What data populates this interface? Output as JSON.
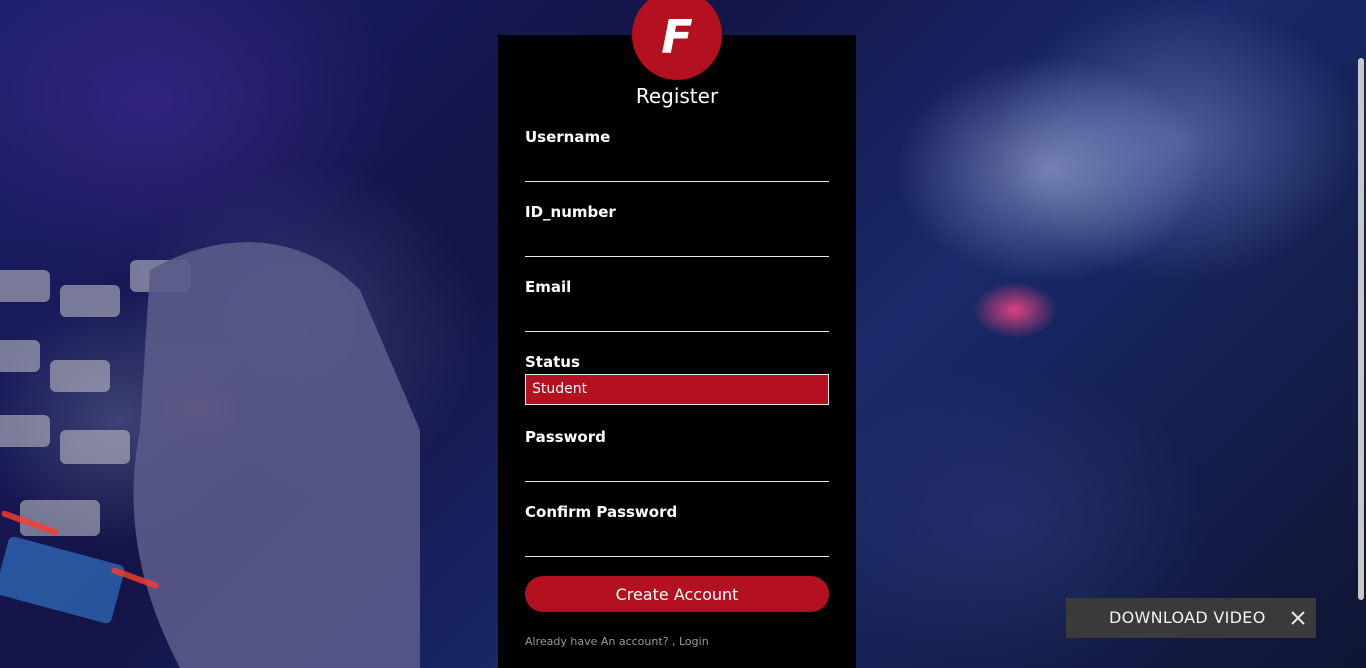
{
  "form": {
    "logo_letter": "F",
    "title": "Register",
    "fields": [
      {
        "label": "Username",
        "value": ""
      },
      {
        "label": "ID_number",
        "value": ""
      },
      {
        "label": "Email",
        "value": ""
      }
    ],
    "status": {
      "label": "Status",
      "selected": "Student"
    },
    "password_fields": [
      {
        "label": "Password",
        "value": ""
      },
      {
        "label": "Confirm Password",
        "value": ""
      }
    ],
    "submit_label": "Create Account",
    "login_prompt": "Already have An account? ,",
    "login_link": "Login"
  },
  "download_popup": {
    "label": "DOWNLOAD VIDEO",
    "close_icon": "close-icon"
  },
  "colors": {
    "accent": "#b31020",
    "card_background": "#000000"
  }
}
